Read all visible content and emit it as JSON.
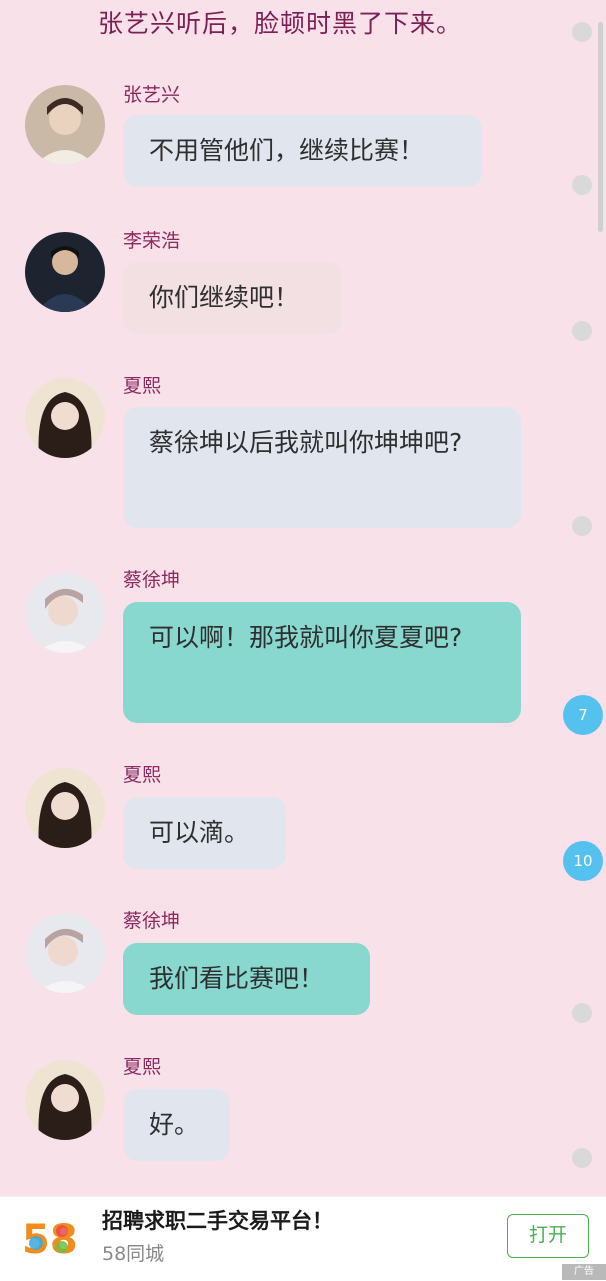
{
  "narration": "张艺兴听后，脸顿时黑了下来。",
  "messages": [
    {
      "sender": "张艺兴",
      "text": "不用管他们，继续比赛！",
      "bubble_color": "#e1e6ee",
      "avatar": "avatar-zhangyixing"
    },
    {
      "sender": "李荣浩",
      "text": "你们继续吧！",
      "bubble_color": "#f3e0e3",
      "avatar": "avatar-lironghao"
    },
    {
      "sender": "夏熙",
      "text": "蔡徐坤以后我就叫你坤坤吧?",
      "bubble_color": "#e1e6ee",
      "avatar": "avatar-xiaxi"
    },
    {
      "sender": "蔡徐坤",
      "text": "可以啊！那我就叫你夏夏吧?",
      "bubble_color": "#88d8cf",
      "avatar": "avatar-caixukun"
    },
    {
      "sender": "夏熙",
      "text": "可以滴。",
      "bubble_color": "#e1e6ee",
      "avatar": "avatar-xiaxi"
    },
    {
      "sender": "蔡徐坤",
      "text": "我们看比赛吧！",
      "bubble_color": "#88d8cf",
      "avatar": "avatar-caixukun"
    },
    {
      "sender": "夏熙",
      "text": "好。",
      "bubble_color": "#e1e6ee",
      "avatar": "avatar-xiaxi"
    }
  ],
  "scroll_badges": [
    "7",
    "10"
  ],
  "ad": {
    "logo_text": "58",
    "title": "招聘求职二手交易平台！",
    "subtitle": "58同城",
    "button": "打开",
    "tag": "广告"
  }
}
